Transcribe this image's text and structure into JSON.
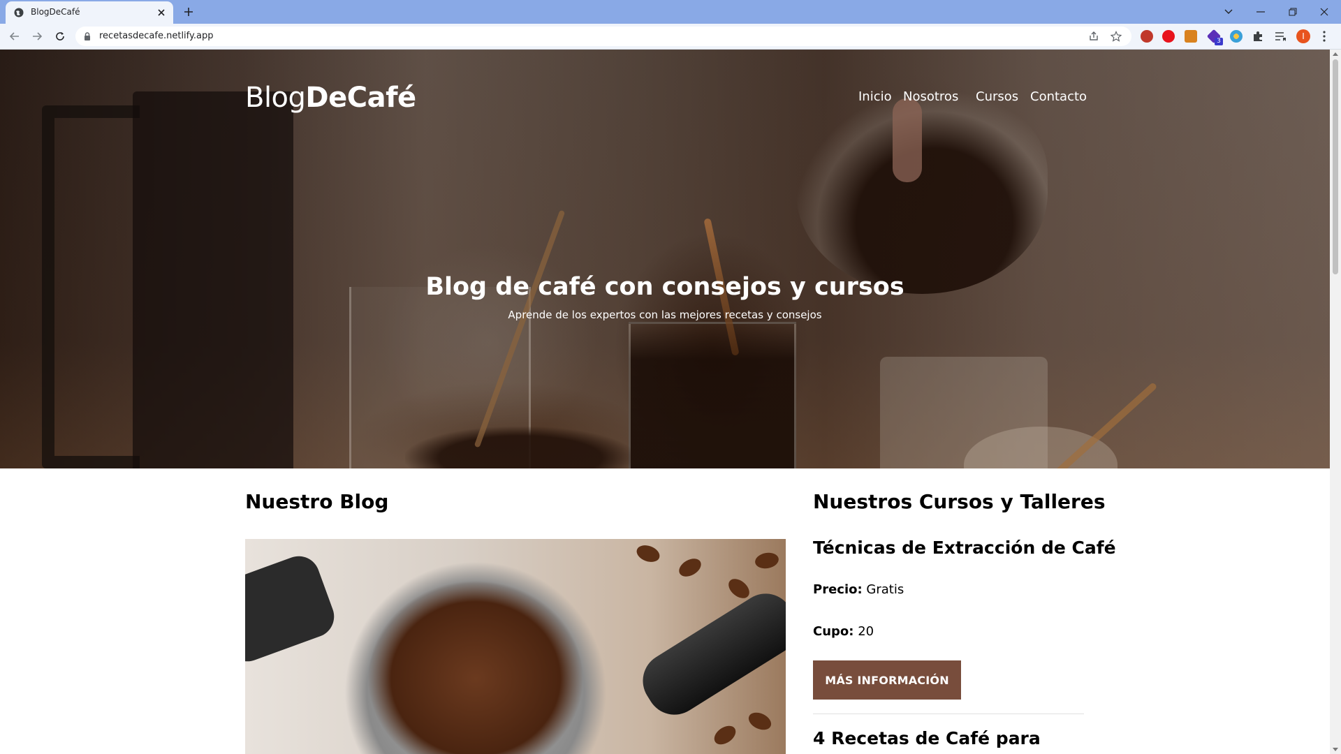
{
  "browser": {
    "tab_title": "BlogDeCafé",
    "url": "recetasdecafe.netlify.app",
    "profile_initial": "I",
    "extension_badge": "3"
  },
  "site": {
    "logo_light": "Blog",
    "logo_bold": "DeCafé",
    "nav": [
      "Inicio",
      "Nosotros",
      "Cursos",
      "Contacto"
    ]
  },
  "hero": {
    "title": "Blog de café con consejos y cursos",
    "subtitle": "Aprende de los expertos con las mejores recetas y consejos"
  },
  "blog": {
    "heading": "Nuestro Blog"
  },
  "courses": {
    "heading": "Nuestros Cursos y Talleres",
    "items": [
      {
        "title": "Técnicas de Extracción de Café",
        "price_label": "Precio:",
        "price_value": "Gratis",
        "capacity_label": "Cupo:",
        "capacity_value": "20",
        "button_label": "MÁS INFORMACIÓN"
      },
      {
        "title": "4 Recetas de Café para"
      }
    ]
  },
  "colors": {
    "tabstrip": "#89a9e6",
    "toolbar": "#f0f4fb",
    "button": "#784d3c"
  }
}
